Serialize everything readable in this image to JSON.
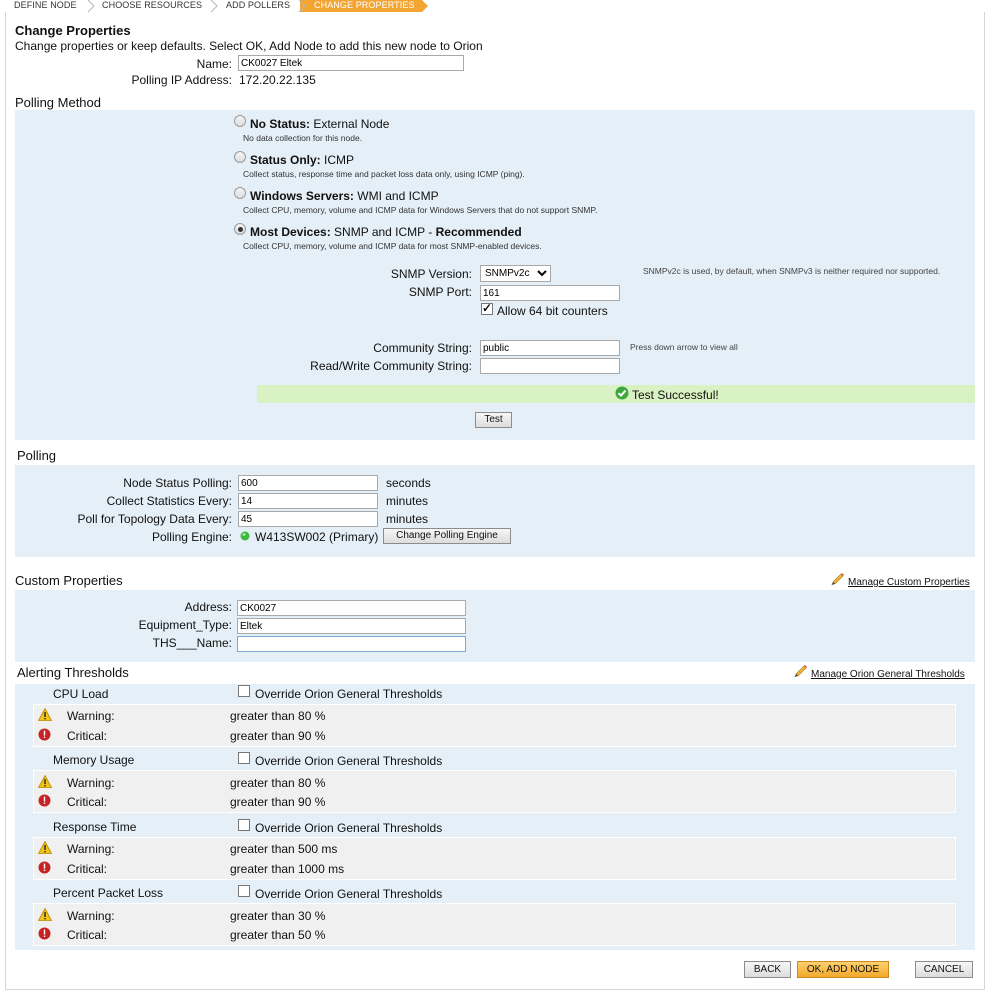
{
  "wizard": {
    "steps": [
      "DEFINE NODE",
      "CHOOSE RESOURCES",
      "ADD POLLERS",
      "CHANGE PROPERTIES"
    ],
    "active_index": 3
  },
  "header": {
    "title": "Change Properties",
    "subtitle": "Change properties or keep defaults. Select OK, Add Node to add this new node to Orion",
    "name_label": "Name:",
    "name_value": "CK0027 Eltek",
    "ip_label": "Polling IP Address:",
    "ip_value": "172.20.22.135"
  },
  "polling_method": {
    "section_label": "Polling Method",
    "options": [
      {
        "title_bold": "No Status:",
        "title_rest": " External Node",
        "desc": "No data collection for this node.",
        "selected": false
      },
      {
        "title_bold": "Status Only:",
        "title_rest": " ICMP",
        "desc": "Collect status, response time and packet loss data only, using ICMP (ping).",
        "selected": false
      },
      {
        "title_bold": "Windows Servers:",
        "title_rest": " WMI and ICMP",
        "desc": "Collect CPU, memory, volume and ICMP data for Windows Servers that do not support SNMP.",
        "selected": false
      },
      {
        "title_bold": "Most Devices:",
        "title_rest": " SNMP and ICMP - ",
        "title_bold2": "Recommended",
        "desc": "Collect CPU, memory, volume and ICMP data for most SNMP-enabled devices.",
        "selected": true
      }
    ],
    "snmp_version_label": "SNMP Version:",
    "snmp_version_value": "SNMPv2c",
    "snmp_version_hint": "SNMPv2c is used, by default, when SNMPv3 is neither required nor supported.",
    "snmp_port_label": "SNMP Port:",
    "snmp_port_value": "161",
    "counters_label": "Allow 64 bit counters",
    "counters_checked": true,
    "community_label": "Community String:",
    "community_value": "public",
    "community_hint": "Press down arrow to view all",
    "rw_community_label": "Read/Write Community String:",
    "rw_community_value": "",
    "test_result": "Test Successful!",
    "test_button": "Test"
  },
  "polling": {
    "section_label": "Polling",
    "rows": [
      {
        "label": "Node Status Polling:",
        "value": "600",
        "unit": "seconds"
      },
      {
        "label": "Collect Statistics Every:",
        "value": "14",
        "unit": "minutes"
      },
      {
        "label": "Poll for Topology Data Every:",
        "value": "45",
        "unit": "minutes"
      }
    ],
    "engine_label": "Polling Engine:",
    "engine_value": "W413SW002 (Primary)",
    "engine_button": "Change Polling Engine",
    "engine_status_color": "#3cb83c"
  },
  "custom_properties": {
    "section_label": "Custom Properties",
    "manage_link": "Manage Custom Properties",
    "fields": [
      {
        "label": "Address:",
        "value": "CK0027"
      },
      {
        "label": "Equipment_Type:",
        "value": "Eltek"
      },
      {
        "label": "THS___Name:",
        "value": ""
      }
    ]
  },
  "alerting": {
    "section_label": "Alerting Thresholds",
    "manage_link": "Manage Orion General Thresholds",
    "override_label": "Override Orion General Thresholds",
    "warning_label": "Warning:",
    "critical_label": "Critical:",
    "groups": [
      {
        "name": "CPU Load",
        "warning": "greater than 80 %",
        "critical": "greater than 90 %"
      },
      {
        "name": "Memory Usage",
        "warning": "greater than 80 %",
        "critical": "greater than 90 %"
      },
      {
        "name": "Response Time",
        "warning": "greater than 500 ms",
        "critical": "greater than 1000 ms"
      },
      {
        "name": "Percent Packet Loss",
        "warning": "greater than 30 %",
        "critical": "greater than 50 %"
      }
    ]
  },
  "footer": {
    "back": "BACK",
    "ok": "OK, ADD NODE",
    "cancel": "CANCEL"
  },
  "colors": {
    "accent": "#f3a534",
    "panel": "#e4eff7",
    "success": "#d9f2c4"
  }
}
